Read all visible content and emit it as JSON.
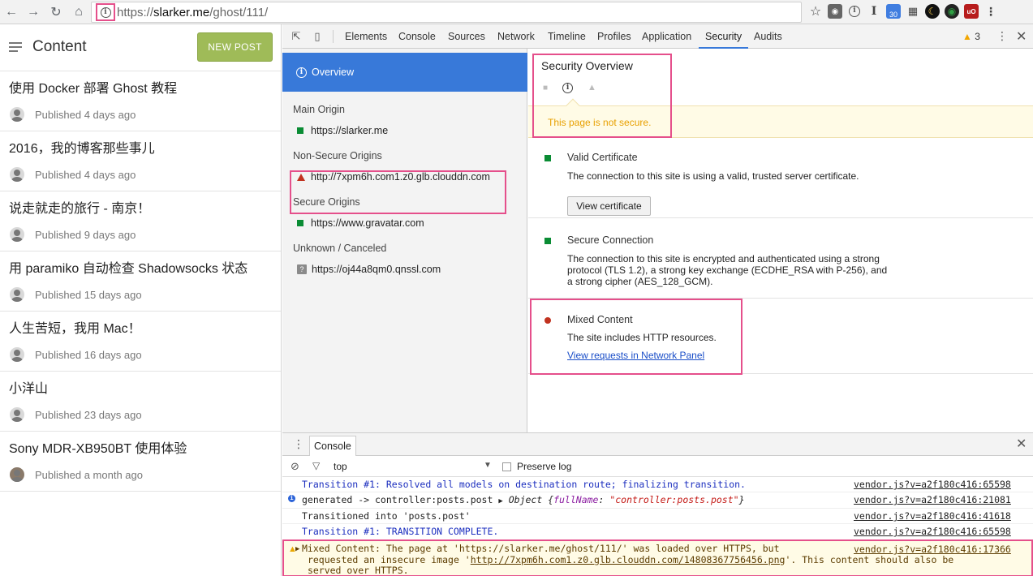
{
  "browser": {
    "url_prefix": "https://",
    "url_host": "slarker.me",
    "url_path": "/ghost/111/",
    "extensions": [
      "star-icon",
      "shield-ext-icon",
      "info-ext-icon",
      "instapaper-ext-icon",
      "calendar-ext-icon",
      "qr-ext-icon",
      "moon-ext-icon",
      "chrome-ext-icon",
      "ublock-ext-icon"
    ],
    "calendar_badge": "30",
    "instapaper_glyph": "I"
  },
  "ghost": {
    "title": "Content",
    "new_post": "NEW POST",
    "posts": [
      {
        "title": "使用 Docker 部署 Ghost 教程",
        "date": "Published 4 days ago"
      },
      {
        "title": "2016，我的博客那些事儿",
        "date": "Published 4 days ago"
      },
      {
        "title": "说走就走的旅行 - 南京！",
        "date": "Published 9 days ago"
      },
      {
        "title": "用 paramiko 自动检查 Shadowsocks 状态",
        "date": "Published 15 days ago"
      },
      {
        "title": "人生苦短，我用 Mac！",
        "date": "Published 16 days ago"
      },
      {
        "title": "小洋山",
        "date": "Published 23 days ago"
      },
      {
        "title": "Sony MDR-XB950BT 使用体验",
        "date": "Published a month ago"
      }
    ]
  },
  "devtools": {
    "tabs": [
      "Elements",
      "Console",
      "Sources",
      "Network",
      "Timeline",
      "Profiles",
      "Application",
      "Security",
      "Audits"
    ],
    "active_tab": "Security",
    "warning_count": "3",
    "sidebar": {
      "overview": "Overview",
      "main_origin_title": "Main Origin",
      "main_origin": "https://slarker.me",
      "non_secure_title": "Non-Secure Origins",
      "non_secure_origin": "http://7xpm6h.com1.z0.glb.clouddn.com",
      "secure_title": "Secure Origins",
      "secure_origin": "https://www.gravatar.com",
      "unknown_title": "Unknown / Canceled",
      "unknown_origin": "https://oj44a8qm0.qnssl.com",
      "unknown_glyph": "?"
    },
    "main": {
      "title": "Security Overview",
      "banner": "This page is not secure.",
      "cert_title": "Valid Certificate",
      "cert_desc": "The connection to this site is using a valid, trusted server certificate.",
      "cert_button": "View certificate",
      "conn_title": "Secure Connection",
      "conn_desc": "The connection to this site is encrypted and authenticated using a strong protocol (TLS 1.2), a strong key exchange (ECDHE_RSA with P-256), and a strong cipher (AES_128_GCM).",
      "mixed_title": "Mixed Content",
      "mixed_desc": "The site includes HTTP resources.",
      "mixed_link": "View requests in Network Panel"
    },
    "console": {
      "tab": "Console",
      "context": "top",
      "preserve_log": "Preserve log",
      "logs": [
        {
          "msg": "Transition #1: Resolved all models on destination route; finalizing transition.",
          "src": "vendor.js?v=a2f180c416:65598"
        },
        {
          "msg": "generated -> controller:posts.post ",
          "obj_open": "Object {",
          "obj_key": "fullName",
          "obj_sep": ": ",
          "obj_val": "\"controller:posts.post\"",
          "obj_close": "}",
          "src": "vendor.js?v=a2f180c416:21081"
        },
        {
          "msg": "Transitioned into 'posts.post'",
          "src": "vendor.js?v=a2f180c416:41618"
        },
        {
          "msg": "Transition #1: TRANSITION COMPLETE.",
          "src": "vendor.js?v=a2f180c416:65598"
        }
      ],
      "warning": {
        "line1": "Mixed Content: The page at 'https://slarker.me/ghost/111/' was loaded over HTTPS, but",
        "line2_pre": "requested an insecure image '",
        "line2_link": "http://7xpm6h.com1.z0.glb.clouddn.com/14808367756456.png",
        "line2_post": "'. This content should also be",
        "line3": "served over HTTPS.",
        "src": "vendor.js?v=a2f180c416:17366"
      }
    }
  },
  "colors": {
    "accent": "#3879d9",
    "new_post": "#9fbb58",
    "secure": "#0a8c34",
    "insecure": "#c1321f",
    "warning": "#e8a000",
    "highlight": "#e54f8b"
  }
}
